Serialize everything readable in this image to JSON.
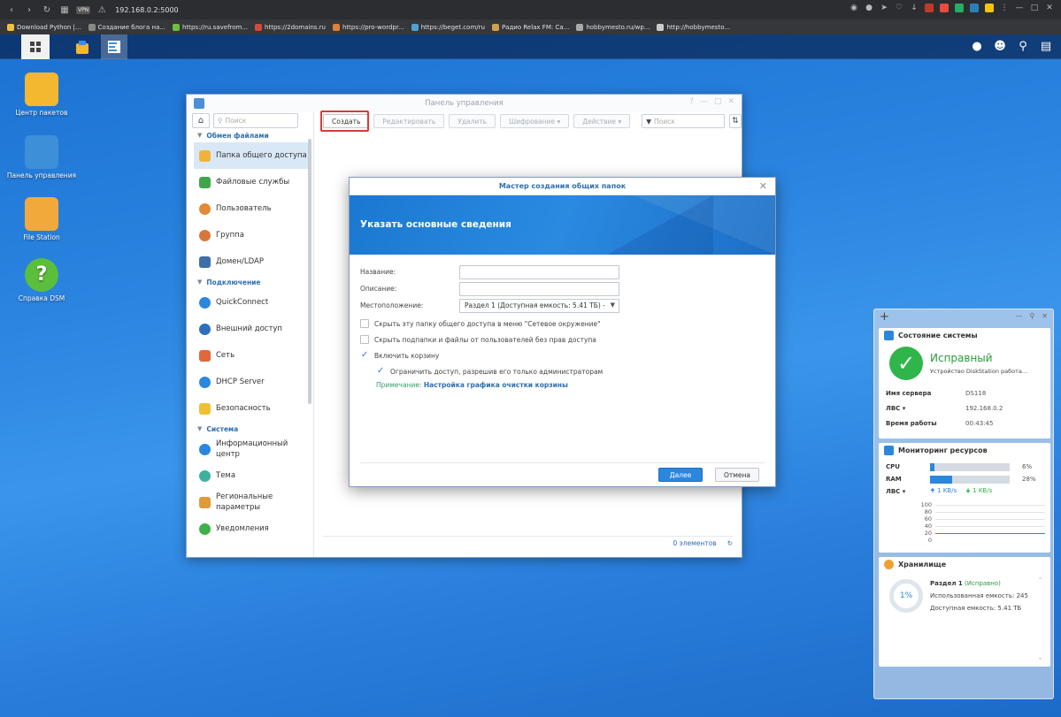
{
  "browser": {
    "url": "192.168.0.2:5000",
    "vpn": "VPN",
    "bookmarks": [
      {
        "label": "Download Python |...",
        "color": "#f0c040"
      },
      {
        "label": "Создание блога на...",
        "color": "#888888"
      },
      {
        "label": "https://ru.savefrom...",
        "color": "#6fbf3f"
      },
      {
        "label": "https://2domains.ru",
        "color": "#d44a3a"
      },
      {
        "label": "https://pro-wordpr...",
        "color": "#e0803a"
      },
      {
        "label": "https://beget.com/ru",
        "color": "#50a0d8"
      },
      {
        "label": "Радио Relax FM: Са...",
        "color": "#d0a050"
      },
      {
        "label": "hobbymesto.ru/wp...",
        "color": "#aaaaaa"
      },
      {
        "label": "http://hobbymesto...",
        "color": "#cccccc"
      }
    ]
  },
  "desktop": {
    "icons": [
      {
        "label": "Центр пакетов",
        "color": "#f4b730"
      },
      {
        "label": "Панель управления",
        "color": "#3d8fd8"
      },
      {
        "label": "File Station",
        "color": "#f2a93b"
      },
      {
        "label": "Справка DSM",
        "color": "#5bbf3c"
      }
    ]
  },
  "control_panel": {
    "title": "Панель управления",
    "search_placeholder": "Поиск",
    "sections": {
      "file_sharing": "Обмен файлами",
      "connectivity": "Подключение",
      "system": "Система"
    },
    "items_sharing": [
      {
        "label": "Папка общего доступа",
        "color": "#f0b33a"
      },
      {
        "label": "Файловые службы",
        "color": "#3fa54a"
      },
      {
        "label": "Пользователь",
        "color": "#e08a3a"
      },
      {
        "label": "Группа",
        "color": "#d9763a"
      },
      {
        "label": "Домен/LDAP",
        "color": "#3d6fa8"
      }
    ],
    "items_connect": [
      {
        "label": "QuickConnect",
        "color": "#2b86de"
      },
      {
        "label": "Внешний доступ",
        "color": "#2f6fb8"
      },
      {
        "label": "Сеть",
        "color": "#e0683a"
      },
      {
        "label": "DHCP Server",
        "color": "#2b86de"
      },
      {
        "label": "Безопасность",
        "color": "#f0c030"
      }
    ],
    "items_system": [
      {
        "label": "Информационный центр",
        "color": "#2b86de"
      },
      {
        "label": "Тема",
        "color": "#3fb0a0"
      },
      {
        "label": "Региональные параметры",
        "color": "#e09a3a"
      },
      {
        "label": "Уведомления",
        "color": "#3fb04a"
      }
    ],
    "toolbar": {
      "create": "Создать",
      "edit": "Редактировать",
      "delete": "Удалить",
      "encryption": "Шифрование",
      "action": "Действие",
      "filter_placeholder": "Поиск"
    },
    "footer": {
      "count": "0 элементов"
    }
  },
  "wizard": {
    "title": "Мастер создания общих папок",
    "heading": "Указать основные сведения",
    "fields": {
      "name_label": "Название:",
      "name_value": "",
      "desc_label": "Описание:",
      "desc_value": "",
      "location_label": "Местоположение:",
      "location_value": "Раздел 1 (Доступная емкость:  5.41 ТБ) -"
    },
    "options": [
      {
        "label": "Скрыть эту папку общего доступа в меню \"Сетевое окружение\"",
        "checked": false
      },
      {
        "label": "Скрыть подпапки и файлы от пользователей без прав доступа",
        "checked": false
      },
      {
        "label": "Включить корзину",
        "checked": true
      },
      {
        "label": "Ограничить доступ, разрешив его только администраторам",
        "checked": true
      }
    ],
    "note_label": "Примечание:",
    "note_link": "Настройка графика очистки корзины",
    "next": "Далее",
    "cancel": "Отмена"
  },
  "widgets": {
    "system_status": {
      "title": "Состояние системы",
      "status": "Исправный",
      "status_sub": "Устройство DiskStation работа...",
      "server_name_label": "Имя сервера",
      "server_name": "DS118",
      "lan_label": "ЛВС",
      "lan": "192.168.0.2",
      "uptime_label": "Время работы",
      "uptime": "00:43:45"
    },
    "resource_monitor": {
      "title": "Мониторинг ресурсов",
      "cpu_label": "CPU",
      "cpu": "6%",
      "cpu_level": 6,
      "ram_label": "RAM",
      "ram": "28%",
      "ram_level": 28,
      "lan_label": "ЛВС",
      "up": "1 KB/s",
      "down": "1 KB/s",
      "y_ticks": [
        "100",
        "80",
        "60",
        "40",
        "20",
        "0"
      ]
    },
    "storage": {
      "title": "Хранилище",
      "percent": "1%",
      "volume_label": "Раздел 1",
      "volume_status": "(Исправно)",
      "used": "Использованная емкость: 245",
      "available": "Доступная емкость: 5.41 ТБ"
    }
  }
}
